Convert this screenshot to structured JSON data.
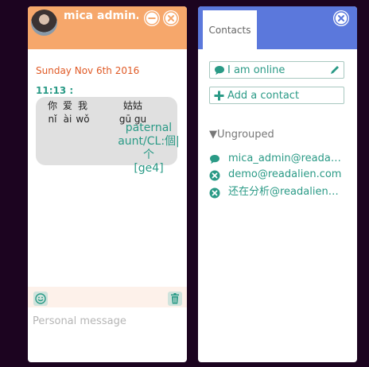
{
  "chat": {
    "title": "mica admin…",
    "date": "Sunday Nov 6th 2016",
    "message": {
      "time": "11:13 :",
      "words": [
        {
          "hanzi": "你",
          "pinyin": "nǐ"
        },
        {
          "hanzi": "爱",
          "pinyin": "ài"
        },
        {
          "hanzi": "我",
          "pinyin": "wǒ"
        },
        {
          "hanzi": "姑姑",
          "pinyin": "gū gu"
        }
      ],
      "definition": [
        "paternal",
        "aunt/CL:個|个",
        "[ge4]"
      ]
    },
    "input_placeholder": "Personal message"
  },
  "contacts": {
    "tab_label": "Contacts",
    "status_label": "I am online",
    "add_label": "Add a contact",
    "group_label": "Ungrouped",
    "list": [
      {
        "name": "mica_admin@reada…",
        "status": "online"
      },
      {
        "name": "demo@readalien.com",
        "status": "offline"
      },
      {
        "name": "还在分析@readalien…",
        "status": "offline"
      }
    ]
  },
  "colors": {
    "chat_header": "#f6a76b",
    "contacts_header": "#5b78dc",
    "accent": "#2a9a86",
    "date": "#e05a26",
    "bubble": "#e0e0e0"
  }
}
